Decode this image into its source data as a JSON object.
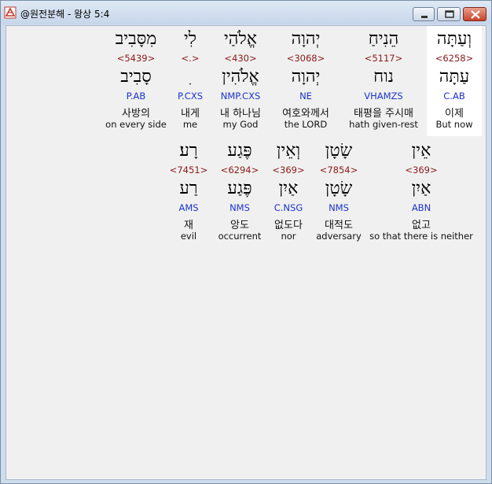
{
  "window": {
    "title": "@원전분해 - 왕상 5:4",
    "controls": {
      "minimize": "minimize",
      "maximize": "maximize",
      "close": "close"
    }
  },
  "rows": [
    {
      "words": [
        {
          "hebrew": "וְעַתָּה",
          "strong": "<6258>",
          "lemma": "עַתָּה",
          "parse": "C.AB",
          "korean": "이제",
          "english": "But now"
        },
        {
          "hebrew": "הֵנִיחַ",
          "strong": "<5117>",
          "lemma": "נוח",
          "parse": "VHAMZS",
          "korean": "태평을 주시매",
          "english": "hath given-rest"
        },
        {
          "hebrew": "יְהוָה",
          "strong": "<3068>",
          "lemma": "יְהוָה",
          "parse": "NE",
          "korean": "여호와께서",
          "english": "the LORD"
        },
        {
          "hebrew": "אֱלֹהַי",
          "strong": "<430>",
          "lemma": "אֱלֹהִין",
          "parse": "NMP.CXS",
          "korean": "내 하나님",
          "english": "my God"
        },
        {
          "hebrew": "לִי",
          "strong": "<.>",
          "lemma": "ִ",
          "parse": "P.CXS",
          "korean": "내게",
          "english": "me"
        },
        {
          "hebrew": "מִסָּבִיב",
          "strong": "<5439>",
          "lemma": "סָבִיב",
          "parse": "P.AB",
          "korean": "사방의",
          "english": "on every side"
        }
      ]
    },
    {
      "words": [
        {
          "hebrew": "אֵין",
          "strong": "<369>",
          "lemma": "אַיִן",
          "parse": "ABN",
          "korean": "없고",
          "english": "so that there is neither"
        },
        {
          "hebrew": "שָׂטָן",
          "strong": "<7854>",
          "lemma": "שָׂטָן",
          "parse": "NMS",
          "korean": "대적도",
          "english": "adversary"
        },
        {
          "hebrew": "וְאֵין",
          "strong": "<369>",
          "lemma": "אַיִן",
          "parse": "C.NSG",
          "korean": "없도다",
          "english": "nor"
        },
        {
          "hebrew": "פֶּגַע",
          "strong": "<6294>",
          "lemma": "פֶּגַע",
          "parse": "NMS",
          "korean": "앙도",
          "english": "occurrent"
        },
        {
          "hebrew": "רָע׃",
          "strong": "<7451>",
          "lemma": "רַע",
          "parse": "AMS",
          "korean": "재",
          "english": "evil"
        }
      ]
    }
  ]
}
